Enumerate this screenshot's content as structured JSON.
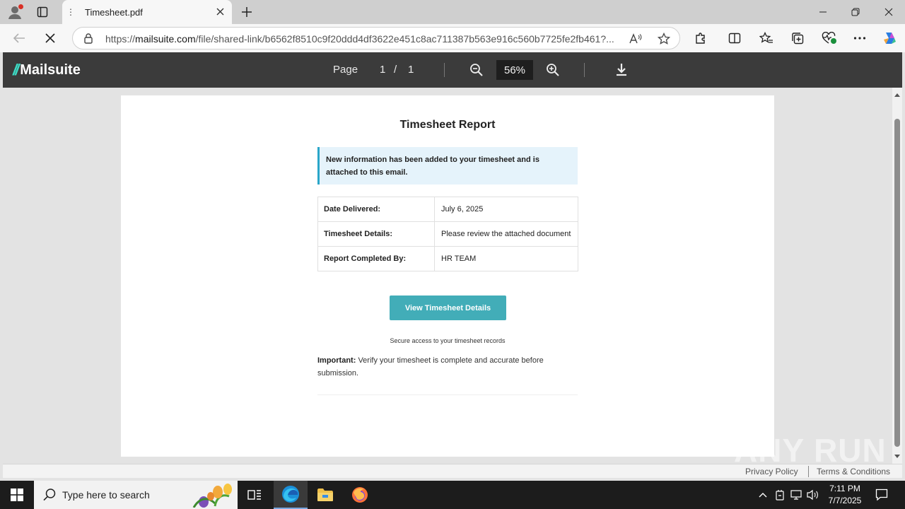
{
  "browser": {
    "tab_title": "Timesheet.pdf",
    "url_scheme": "https://",
    "url_host": "mailsuite.com",
    "url_path": "/file/shared-link/b6562f8510c9f20ddd4df3622e451c8ac711387b563e916c560b7725fe2fb461?..."
  },
  "viewer": {
    "logo_mark": "//",
    "logo_text": "Mailsuite",
    "page_label": "Page",
    "page_current": "1",
    "page_slash": "/",
    "page_total": "1",
    "zoom": "56%"
  },
  "document": {
    "title": "Timesheet Report",
    "notice": "New information has been added to your timesheet and is attached to this email.",
    "rows": [
      {
        "label": "Date Delivered:",
        "value": "July 6, 2025"
      },
      {
        "label": "Timesheet Details:",
        "value": "Please review the attached document"
      },
      {
        "label": "Report Completed By:",
        "value": "HR TEAM"
      }
    ],
    "cta_label": "View Timesheet Details",
    "secure_text": "Secure access to your timesheet records",
    "important_label": "Important:",
    "important_text": " Verify your timesheet is complete and accurate before submission."
  },
  "footer": {
    "privacy": "Privacy Policy",
    "terms": "Terms & Conditions"
  },
  "watermark": "ANY RUN",
  "taskbar": {
    "search_placeholder": "Type here to search",
    "time": "7:11 PM",
    "date": "7/7/2025"
  },
  "colors": {
    "accent_teal": "#42adb8",
    "logo_teal": "#3ddbc5",
    "notice_border": "#2aa6c9",
    "notice_bg": "#e5f3fb",
    "viewer_bar": "#3b3b3b"
  },
  "icons": {
    "profile": "profile-icon",
    "tab_actions": "tab-actions-icon",
    "close": "close-icon",
    "new_tab": "plus-icon",
    "back": "back-arrow-icon",
    "stop": "stop-loading-icon",
    "lock": "site-info-icon",
    "read_aloud": "read-aloud-icon",
    "favorite": "star-icon",
    "zoom_out": "zoom-out-icon",
    "zoom_in": "zoom-in-icon",
    "download": "download-icon"
  }
}
